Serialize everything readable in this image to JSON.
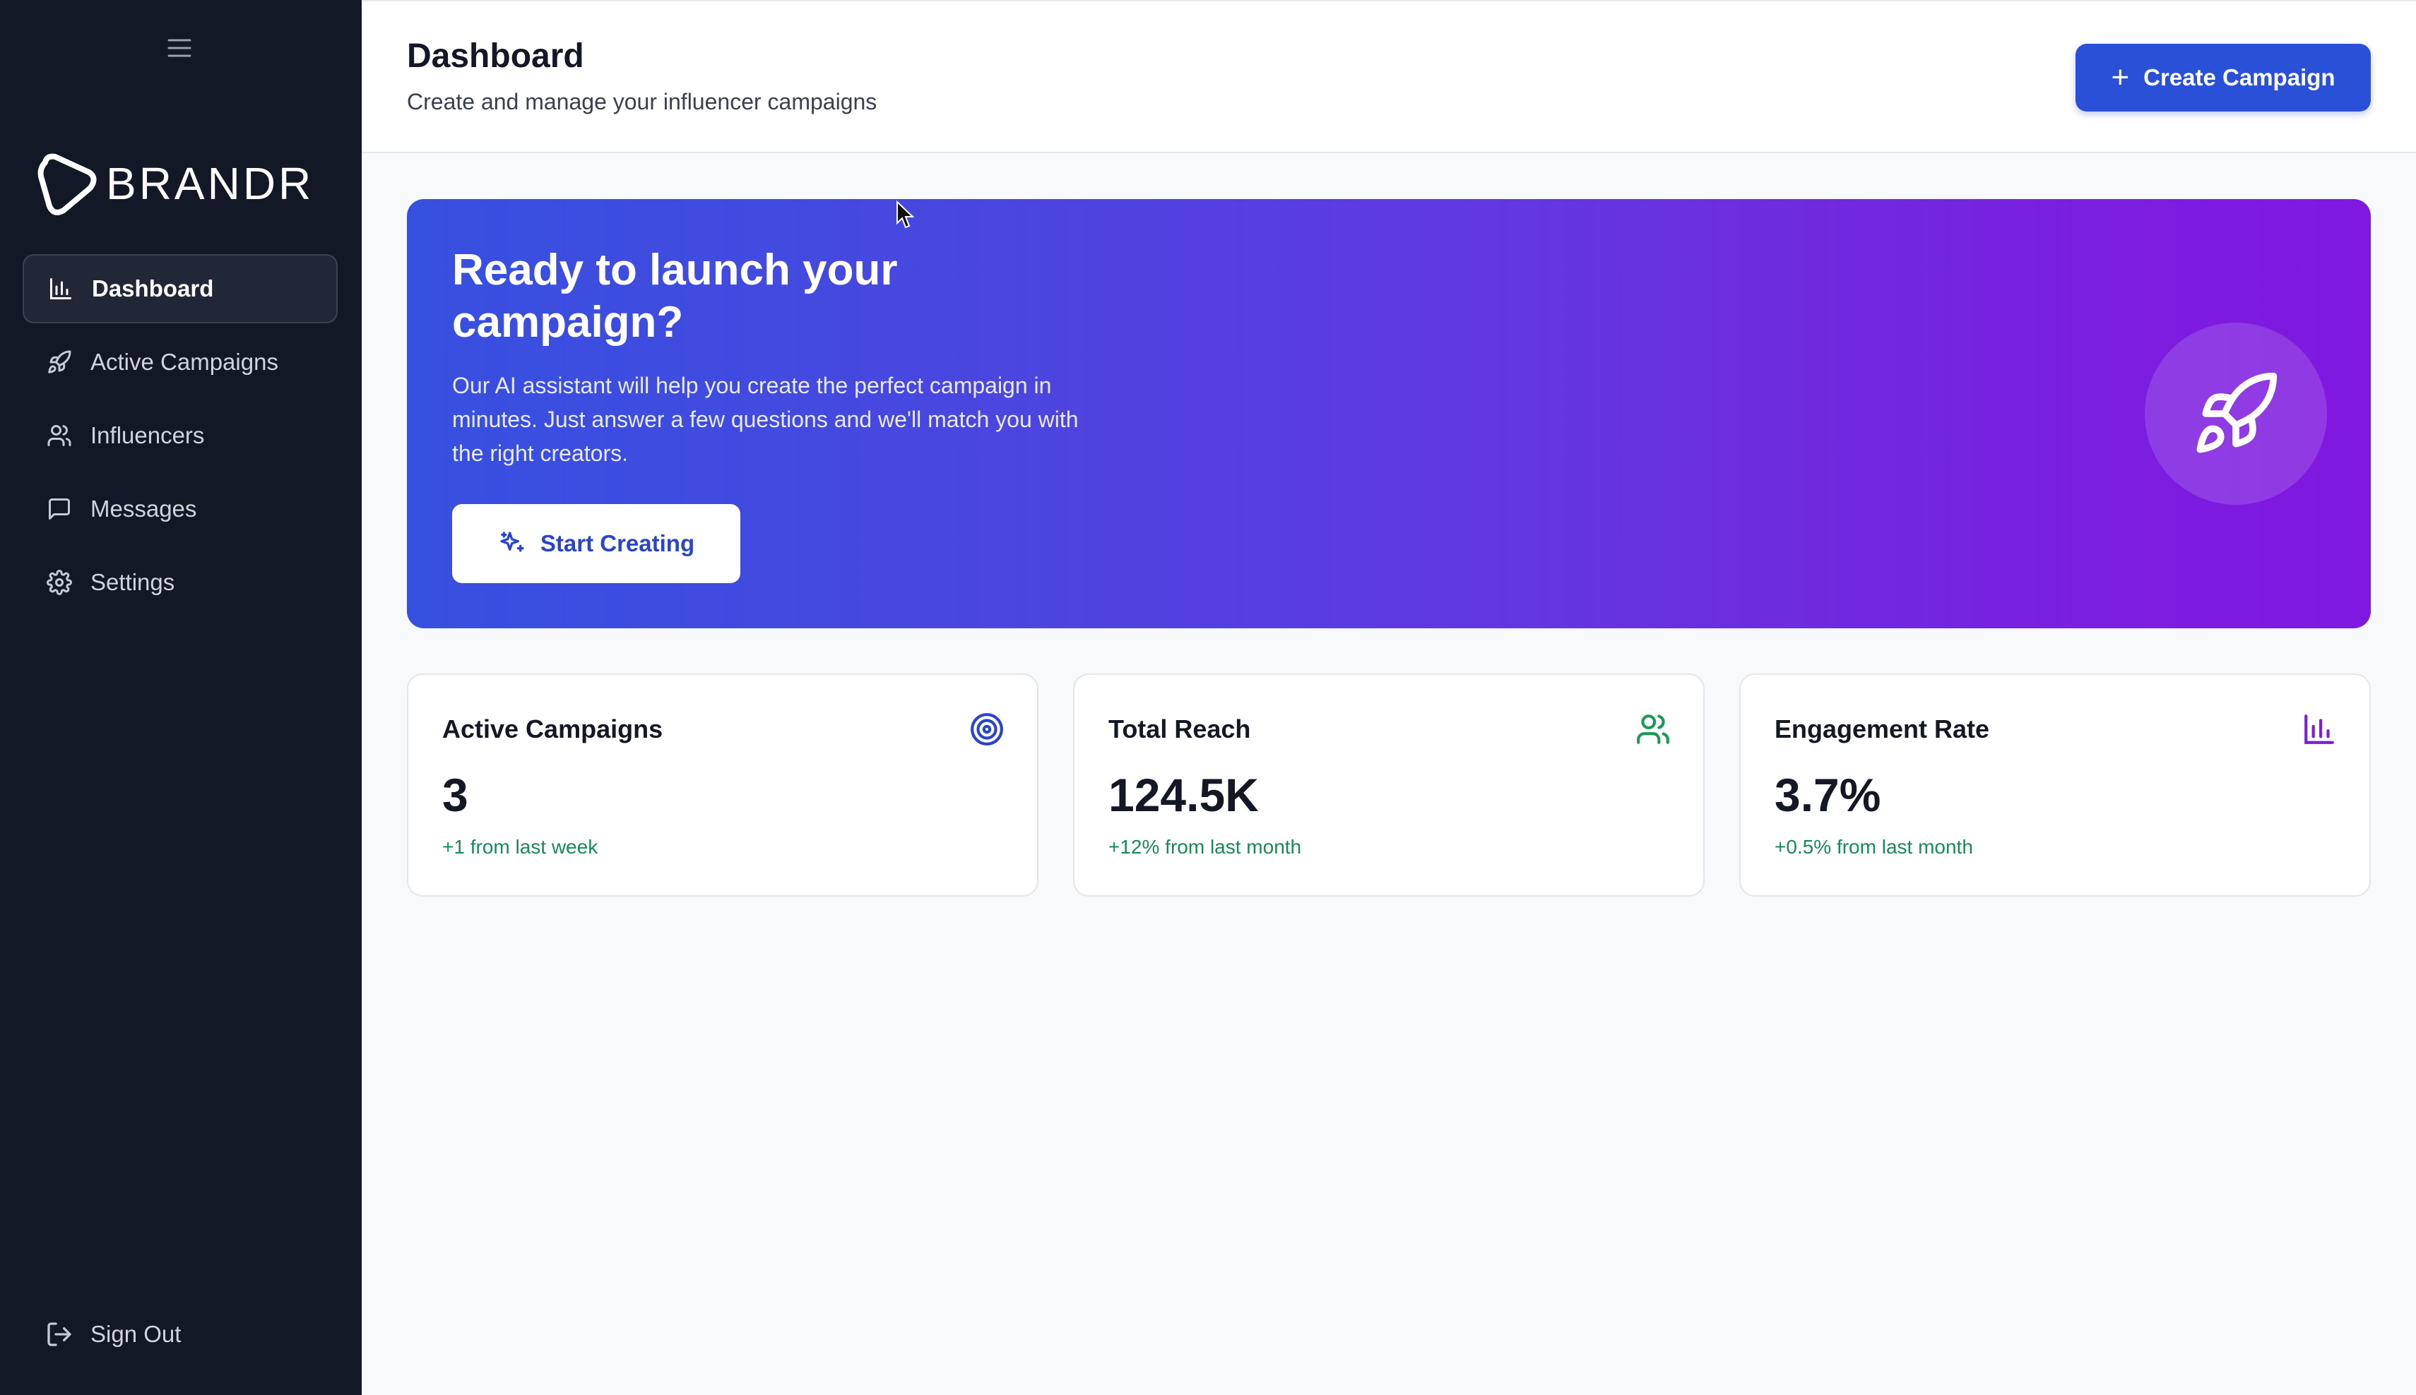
{
  "sidebar": {
    "menu_icon": "hamburger-menu-icon",
    "logo_text": "BRANDR",
    "items": [
      {
        "label": "Dashboard",
        "icon": "bar-chart-icon",
        "active": true
      },
      {
        "label": "Active Campaigns",
        "icon": "rocket-icon",
        "active": false
      },
      {
        "label": "Influencers",
        "icon": "users-icon",
        "active": false
      },
      {
        "label": "Messages",
        "icon": "message-square-icon",
        "active": false
      },
      {
        "label": "Settings",
        "icon": "gear-icon",
        "active": false
      }
    ],
    "signout_label": "Sign Out"
  },
  "header": {
    "title": "Dashboard",
    "subtitle": "Create and manage your influencer campaigns",
    "create_label": "Create Campaign"
  },
  "hero": {
    "title": "Ready to launch your campaign?",
    "text": "Our AI assistant will help you create the perfect campaign in minutes. Just answer a few questions and we'll match you with the right creators.",
    "button_label": "Start Creating",
    "icon": "rocket-icon"
  },
  "stats": [
    {
      "title": "Active Campaigns",
      "value": "3",
      "delta": "+1 from last week",
      "icon": "target-icon",
      "color": "#2a45c8"
    },
    {
      "title": "Total Reach",
      "value": "124.5K",
      "delta": "+12% from last month",
      "icon": "users-icon",
      "color": "#1d9a5a"
    },
    {
      "title": "Engagement Rate",
      "value": "3.7%",
      "delta": "+0.5% from last month",
      "icon": "bar-chart-icon",
      "color": "#7a1fd6"
    }
  ],
  "colors": {
    "sidebar_bg": "#131827",
    "primary": "#2a50d8",
    "positive": "#178b57"
  }
}
